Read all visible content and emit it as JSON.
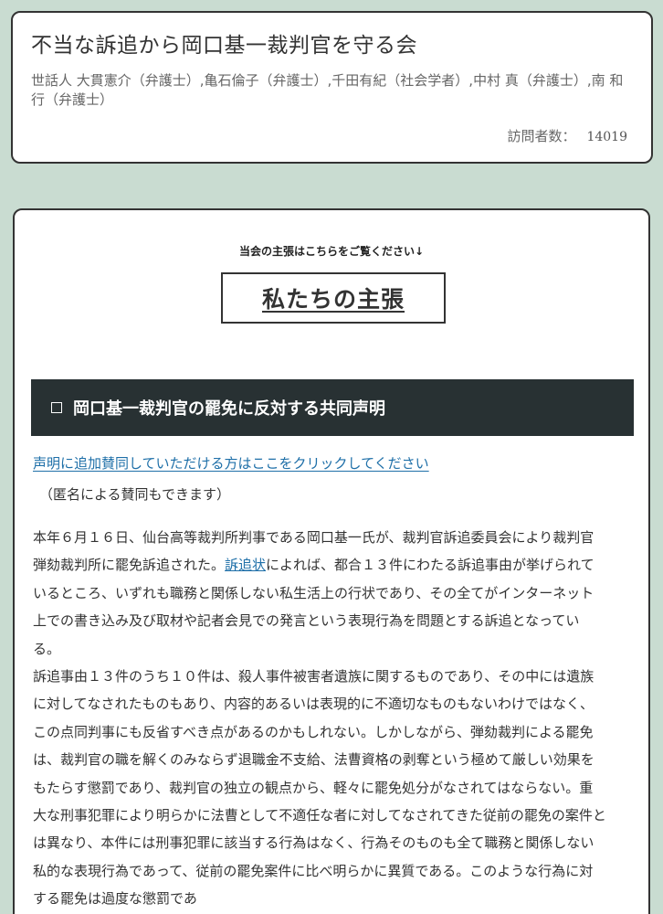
{
  "header": {
    "title": "不当な訴追から岡口基一裁判官を守る会",
    "caretakers": "世話人 大貫憲介（弁護士）,亀石倫子（弁護士）,千田有紀（社会学者）,中村 真（弁護士）,南 和行（弁護士）",
    "visitors_label": "訪問者数：",
    "visitors_count": "14019"
  },
  "main": {
    "intro": "当会の主張はこちらをご覧ください↓",
    "claims_button": "私たちの主張",
    "section_heading": "岡口基一裁判官の罷免に反対する共同声明",
    "endorse_link": "声明に追加賛同していただける方はここをクリックしてください",
    "anon_note": "（匿名による賛同もできます）",
    "paragraph1_a": "本年６月１６日、仙台高等裁判所判事である岡口基一氏が、裁判官訴追委員会により裁判官弾劾裁判所に罷免訴追された。",
    "paragraph1_link": "訴追状",
    "paragraph1_b": "によれば、都合１３件にわたる訴追事由が挙げられているところ、いずれも職務と関係しない私生活上の行状であり、その全てがインターネット上での書き込み及び取材や記者会見での発言という表現行為を問題とする訴追となっている。",
    "paragraph2": "訴追事由１３件のうち１０件は、殺人事件被害者遺族に関するものであり、その中には遺族に対してなされたものもあり、内容的あるいは表現的に不適切なものもないわけではなく、この点同判事にも反省すべき点があるのかもしれない。しかしながら、弾劾裁判による罷免は、裁判官の職を解くのみならず退職金不支給、法曹資格の剥奪という極めて厳しい効果をもたらす懲罰であり、裁判官の独立の観点から、軽々に罷免処分がなされてはならない。重大な刑事犯罪により明らかに法曹として不適任な者に対してなされてきた従前の罷免の案件とは異なり、本件には刑事犯罪に該当する行為はなく、行為そのものも全て職務と関係しない私的な表現行為であって、従前の罷免案件に比べ明らかに異質である。このような行為に対する罷免は過度な懲罰であ"
  },
  "colors": {
    "background": "#c9dcd1",
    "heading_bg": "#283133",
    "link": "#1e6fa8"
  }
}
